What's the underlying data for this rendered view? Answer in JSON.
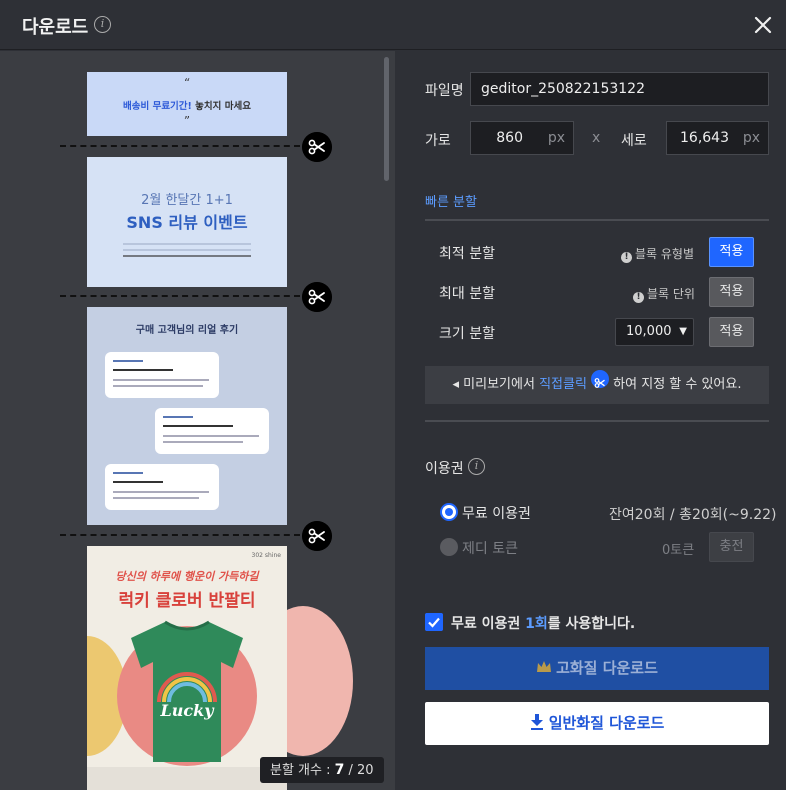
{
  "header": {
    "title": "다운로드",
    "info_icon": "info-icon",
    "close_icon": "close-icon"
  },
  "preview": {
    "slice1": {
      "quote_open": "“",
      "text_bold": "배송비 무료기간!",
      "text_rest": " 놓치지 마세요",
      "quote_close": "”"
    },
    "slice2": {
      "line1": "2월 한달간 1+1",
      "line2": "SNS 리뷰 이벤트"
    },
    "slice3": {
      "heading": "구매 고객님의 리얼 후기"
    },
    "slice4": {
      "brand": "302 shine",
      "line1": "당신의 하루에 행운이 가득하길",
      "line2": "럭키 클로버 반팔티",
      "shirt_text": "Lucky"
    },
    "split_count": {
      "label": "분할 개수 : ",
      "current": "7",
      "separator": " / ",
      "total": "20"
    }
  },
  "panel": {
    "filename_label": "파일명",
    "filename_value": "geditor_250822153122",
    "width_label": "가로",
    "width_value": "860",
    "height_label": "세로",
    "height_value": "16,643",
    "unit": "px",
    "times": "x",
    "quick_split": {
      "title": "빠른 분할",
      "rows": [
        {
          "label": "최적 분할",
          "hint": "블록 유형별",
          "button": "적용"
        },
        {
          "label": "최대 분할",
          "hint": "블록 단위",
          "button": "적용"
        },
        {
          "label": "크기 분할",
          "select": "10,000",
          "button": "적용"
        }
      ],
      "tip_prefix": "◂ 미리보기에서 ",
      "tip_emph": "직접클릭",
      "tip_suffix": " 하여 지정 할 수 있어요."
    },
    "license": {
      "title": "이용권",
      "free": {
        "label": "무료 이용권",
        "status": "잔여20회 / 총20회(~9.22)"
      },
      "token": {
        "label": "제디 토큰",
        "status": "0토큰",
        "button": "충전"
      }
    },
    "confirm": {
      "prefix": "무료 이용권 ",
      "emph": "1회",
      "suffix": "를 사용합니다."
    },
    "download_hq": "고화질 다운로드",
    "download_std": "일반화질 다운로드"
  },
  "colors": {
    "accent": "#1f66ff",
    "link": "#5c9cff",
    "background": "#2e3036"
  }
}
